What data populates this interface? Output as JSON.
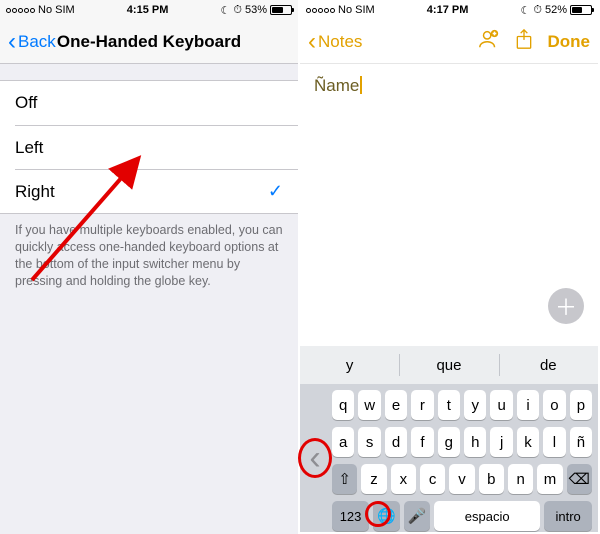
{
  "left": {
    "status": {
      "carrier": "No SIM",
      "time": "4:15 PM",
      "battery_pct": "53%",
      "battery_fill_pct": 53
    },
    "nav": {
      "back_label": "Back",
      "title": "One-Handed Keyboard"
    },
    "options": [
      {
        "label": "Off",
        "selected": false
      },
      {
        "label": "Left",
        "selected": false
      },
      {
        "label": "Right",
        "selected": true
      }
    ],
    "footer": "If you have multiple keyboards enabled, you can quickly access one-handed keyboard options at the bottom of the input switcher menu by pressing and holding the globe key."
  },
  "right": {
    "status": {
      "carrier": "No SIM",
      "time": "4:17 PM",
      "battery_pct": "52%",
      "battery_fill_pct": 52
    },
    "nav": {
      "back_label": "Notes",
      "done_label": "Done"
    },
    "note_text": "Ñame",
    "suggestions": [
      "y",
      "que",
      "de"
    ],
    "keyboard": {
      "row1": [
        "q",
        "w",
        "e",
        "r",
        "t",
        "y",
        "u",
        "i",
        "o",
        "p"
      ],
      "row2": [
        "a",
        "s",
        "d",
        "f",
        "g",
        "h",
        "j",
        "k",
        "l",
        "ñ"
      ],
      "row3": [
        "z",
        "x",
        "c",
        "v",
        "b",
        "n",
        "m"
      ],
      "num_key": "123",
      "space_key": "espacio",
      "return_key": "intro"
    },
    "icons": {
      "moon": "☾",
      "alarm": "⏰",
      "person_add": "person-add",
      "share": "share",
      "add": "+",
      "shift": "⇧",
      "backspace": "⌫",
      "globe": "🌐",
      "mic": "🎤",
      "collapse_chevron": "‹"
    }
  }
}
